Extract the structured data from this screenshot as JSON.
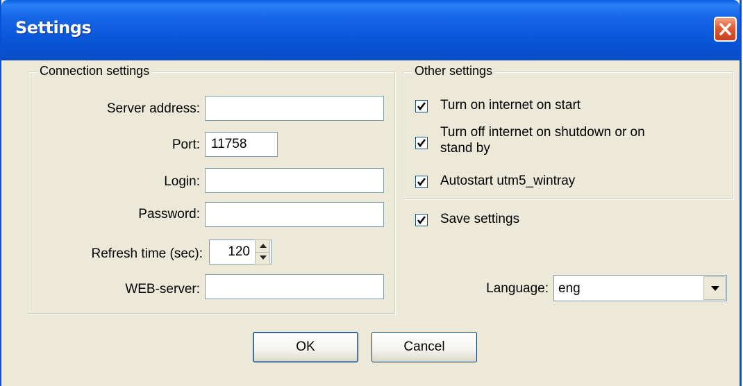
{
  "window": {
    "title": "Settings"
  },
  "connection": {
    "group_label": "Connection settings",
    "server_label": "Server address:",
    "server_value": "",
    "port_label": "Port:",
    "port_value": "11758",
    "login_label": "Login:",
    "login_value": "",
    "password_label": "Password:",
    "password_value": "",
    "refresh_label": "Refresh time (sec):",
    "refresh_value": "120",
    "web_label": "WEB-server:",
    "web_value": ""
  },
  "other": {
    "group_label": "Other settings",
    "options": [
      {
        "label": "Turn on internet on start",
        "checked": true
      },
      {
        "label_line1": "Turn off internet on shutdown or on",
        "label_line2": "stand by",
        "checked": true
      },
      {
        "label": "Autostart utm5_wintray",
        "checked": true
      }
    ]
  },
  "save": {
    "label": "Save settings",
    "checked": true
  },
  "language": {
    "label": "Language:",
    "value": "eng"
  },
  "buttons": {
    "ok": "OK",
    "cancel": "Cancel"
  },
  "colors": {
    "titlebar": "#0954d6",
    "face": "#ece9d8",
    "close": "#e05a35"
  },
  "icons": {
    "close": "close-icon",
    "check": "check-icon",
    "spin": "spin-arrows",
    "dropdown": "chevron-down-icon"
  }
}
